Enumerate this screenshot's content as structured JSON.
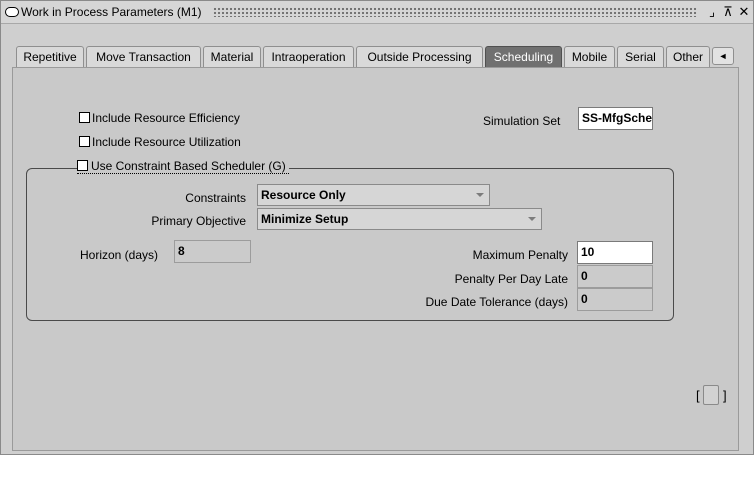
{
  "window": {
    "title": "Work in Process Parameters (M1)",
    "controls": {
      "minimize": "⌟",
      "maximize": "⊼",
      "close": "✕"
    }
  },
  "tabs": [
    {
      "label": "Repetitive",
      "active": false
    },
    {
      "label": "Move Transaction",
      "active": false
    },
    {
      "label": "Material",
      "active": false
    },
    {
      "label": "Intraoperation",
      "active": false
    },
    {
      "label": "Outside Processing",
      "active": false
    },
    {
      "label": "Scheduling",
      "active": true
    },
    {
      "label": "Mobile",
      "active": false
    },
    {
      "label": "Serial",
      "active": false
    },
    {
      "label": "Other",
      "active": false
    }
  ],
  "tab_scroll_icon": "◄",
  "scheduling": {
    "include_resource_efficiency": {
      "label": "Include Resource Efficiency",
      "checked": false
    },
    "include_resource_utilization": {
      "label": "Include Resource Utilization",
      "checked": false
    },
    "simulation_set": {
      "label": "Simulation Set",
      "value": "SS-MfgSche"
    },
    "use_constraint_scheduler": {
      "label": "Use Constraint Based Scheduler (G)",
      "checked": false
    },
    "constraints": {
      "label": "Constraints",
      "value": "Resource Only"
    },
    "primary_objective": {
      "label": "Primary Objective",
      "value": "Minimize Setup"
    },
    "horizon_days": {
      "label": "Horizon (days)",
      "value": "8"
    },
    "maximum_penalty": {
      "label": "Maximum Penalty",
      "value": "10"
    },
    "penalty_per_day_late": {
      "label": "Penalty Per Day Late",
      "value": "0"
    },
    "due_date_tolerance": {
      "label": "Due Date Tolerance (days)",
      "value": "0"
    }
  },
  "footer": {
    "bracket_left": "[",
    "bracket_right": "]"
  },
  "colors": {
    "active_tab": "#707070",
    "canvas": "#c9c9c9",
    "window": "#cfcfcf"
  }
}
